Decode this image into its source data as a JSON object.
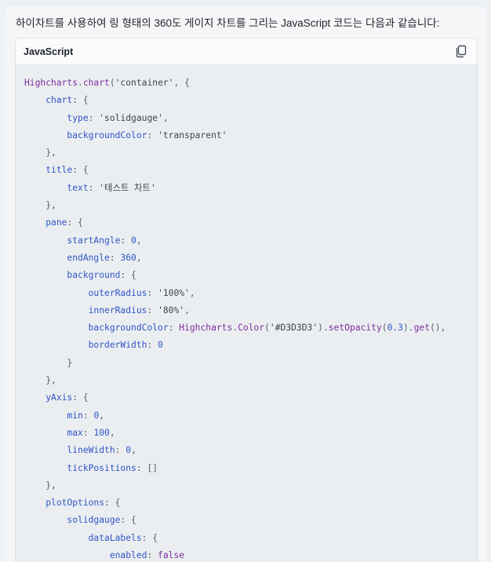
{
  "message": {
    "intro": "하이차트를 사용하여 링 형태의 360도 게이지 차트를 그리는 JavaScript 코드는 다음과 같습니다:"
  },
  "code_block": {
    "language": "JavaScript",
    "copy_icon": "copy-icon",
    "lines": [
      [
        {
          "t": "Highcharts",
          "c": "fn"
        },
        {
          "t": ".",
          "c": "pun"
        },
        {
          "t": "chart",
          "c": "fn"
        },
        {
          "t": "(",
          "c": "pun"
        },
        {
          "t": "'container'",
          "c": "str"
        },
        {
          "t": ", {",
          "c": "pun"
        }
      ],
      [
        {
          "t": "    ",
          "c": "pun"
        },
        {
          "t": "chart",
          "c": "key"
        },
        {
          "t": ": {",
          "c": "pun"
        }
      ],
      [
        {
          "t": "        ",
          "c": "pun"
        },
        {
          "t": "type",
          "c": "key"
        },
        {
          "t": ": ",
          "c": "pun"
        },
        {
          "t": "'solidgauge'",
          "c": "str"
        },
        {
          "t": ",",
          "c": "pun"
        }
      ],
      [
        {
          "t": "        ",
          "c": "pun"
        },
        {
          "t": "backgroundColor",
          "c": "key"
        },
        {
          "t": ": ",
          "c": "pun"
        },
        {
          "t": "'transparent'",
          "c": "str"
        }
      ],
      [
        {
          "t": "    },",
          "c": "pun"
        }
      ],
      [
        {
          "t": "    ",
          "c": "pun"
        },
        {
          "t": "title",
          "c": "key"
        },
        {
          "t": ": {",
          "c": "pun"
        }
      ],
      [
        {
          "t": "        ",
          "c": "pun"
        },
        {
          "t": "text",
          "c": "key"
        },
        {
          "t": ": ",
          "c": "pun"
        },
        {
          "t": "'테스트 차트'",
          "c": "str"
        }
      ],
      [
        {
          "t": "    },",
          "c": "pun"
        }
      ],
      [
        {
          "t": "    ",
          "c": "pun"
        },
        {
          "t": "pane",
          "c": "key"
        },
        {
          "t": ": {",
          "c": "pun"
        }
      ],
      [
        {
          "t": "        ",
          "c": "pun"
        },
        {
          "t": "startAngle",
          "c": "key"
        },
        {
          "t": ": ",
          "c": "pun"
        },
        {
          "t": "0",
          "c": "num"
        },
        {
          "t": ",",
          "c": "pun"
        }
      ],
      [
        {
          "t": "        ",
          "c": "pun"
        },
        {
          "t": "endAngle",
          "c": "key"
        },
        {
          "t": ": ",
          "c": "pun"
        },
        {
          "t": "360",
          "c": "num"
        },
        {
          "t": ",",
          "c": "pun"
        }
      ],
      [
        {
          "t": "        ",
          "c": "pun"
        },
        {
          "t": "background",
          "c": "key"
        },
        {
          "t": ": {",
          "c": "pun"
        }
      ],
      [
        {
          "t": "            ",
          "c": "pun"
        },
        {
          "t": "outerRadius",
          "c": "key"
        },
        {
          "t": ": ",
          "c": "pun"
        },
        {
          "t": "'100%'",
          "c": "str"
        },
        {
          "t": ",",
          "c": "pun"
        }
      ],
      [
        {
          "t": "            ",
          "c": "pun"
        },
        {
          "t": "innerRadius",
          "c": "key"
        },
        {
          "t": ": ",
          "c": "pun"
        },
        {
          "t": "'80%'",
          "c": "str"
        },
        {
          "t": ",",
          "c": "pun"
        }
      ],
      [
        {
          "t": "            ",
          "c": "pun"
        },
        {
          "t": "backgroundColor",
          "c": "key"
        },
        {
          "t": ": ",
          "c": "pun"
        },
        {
          "t": "Highcharts",
          "c": "fn"
        },
        {
          "t": ".",
          "c": "pun"
        },
        {
          "t": "Color",
          "c": "fn"
        },
        {
          "t": "(",
          "c": "pun"
        },
        {
          "t": "'#D3D3D3'",
          "c": "str"
        },
        {
          "t": ").",
          "c": "pun"
        },
        {
          "t": "setOpacity",
          "c": "fn"
        },
        {
          "t": "(",
          "c": "pun"
        },
        {
          "t": "0.3",
          "c": "num"
        },
        {
          "t": ").",
          "c": "pun"
        },
        {
          "t": "get",
          "c": "fn"
        },
        {
          "t": "(),",
          "c": "pun"
        }
      ],
      [
        {
          "t": "            ",
          "c": "pun"
        },
        {
          "t": "borderWidth",
          "c": "key"
        },
        {
          "t": ": ",
          "c": "pun"
        },
        {
          "t": "0",
          "c": "num"
        }
      ],
      [
        {
          "t": "        }",
          "c": "pun"
        }
      ],
      [
        {
          "t": "    },",
          "c": "pun"
        }
      ],
      [
        {
          "t": "    ",
          "c": "pun"
        },
        {
          "t": "yAxis",
          "c": "key"
        },
        {
          "t": ": {",
          "c": "pun"
        }
      ],
      [
        {
          "t": "        ",
          "c": "pun"
        },
        {
          "t": "min",
          "c": "key"
        },
        {
          "t": ": ",
          "c": "pun"
        },
        {
          "t": "0",
          "c": "num"
        },
        {
          "t": ",",
          "c": "pun"
        }
      ],
      [
        {
          "t": "        ",
          "c": "pun"
        },
        {
          "t": "max",
          "c": "key"
        },
        {
          "t": ": ",
          "c": "pun"
        },
        {
          "t": "100",
          "c": "num"
        },
        {
          "t": ",",
          "c": "pun"
        }
      ],
      [
        {
          "t": "        ",
          "c": "pun"
        },
        {
          "t": "lineWidth",
          "c": "key"
        },
        {
          "t": ": ",
          "c": "pun"
        },
        {
          "t": "0",
          "c": "num"
        },
        {
          "t": ",",
          "c": "pun"
        }
      ],
      [
        {
          "t": "        ",
          "c": "pun"
        },
        {
          "t": "tickPositions",
          "c": "key"
        },
        {
          "t": ": []",
          "c": "pun"
        }
      ],
      [
        {
          "t": "    },",
          "c": "pun"
        }
      ],
      [
        {
          "t": "    ",
          "c": "pun"
        },
        {
          "t": "plotOptions",
          "c": "key"
        },
        {
          "t": ": {",
          "c": "pun"
        }
      ],
      [
        {
          "t": "        ",
          "c": "pun"
        },
        {
          "t": "solidgauge",
          "c": "key"
        },
        {
          "t": ": {",
          "c": "pun"
        }
      ],
      [
        {
          "t": "            ",
          "c": "pun"
        },
        {
          "t": "dataLabels",
          "c": "key"
        },
        {
          "t": ": {",
          "c": "pun"
        }
      ],
      [
        {
          "t": "                ",
          "c": "pun"
        },
        {
          "t": "enabled",
          "c": "key"
        },
        {
          "t": ": ",
          "c": "pun"
        },
        {
          "t": "false",
          "c": "kw"
        }
      ]
    ]
  }
}
